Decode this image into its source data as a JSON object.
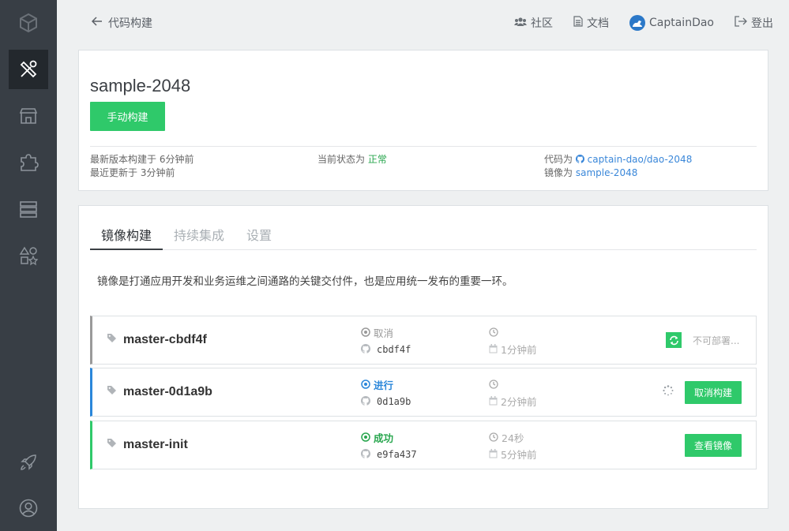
{
  "sidebar": {
    "items": [
      {
        "icon": "logo-cube-icon"
      },
      {
        "icon": "build-tools-icon",
        "active": true
      },
      {
        "icon": "store-icon"
      },
      {
        "icon": "plugin-icon"
      },
      {
        "icon": "server-list-icon"
      },
      {
        "icon": "shapes-icon"
      },
      {
        "icon": "rocket-icon"
      },
      {
        "icon": "user-icon"
      }
    ]
  },
  "topbar": {
    "back_label": "代码构建",
    "community": "社区",
    "docs": "文档",
    "username": "CaptainDao",
    "logout": "登出"
  },
  "app": {
    "name": "sample-2048",
    "build_button": "手动构建",
    "latest_build_label": "最新版本构建于",
    "latest_build_time": "6分钟前",
    "updated_label": "最近更新于",
    "updated_time": "3分钟前",
    "state_label": "当前状态为",
    "state_value": "正常",
    "code_label": "代码为",
    "code_repo": "captain-dao/dao-2048",
    "image_label": "镜像为",
    "image_name": "sample-2048"
  },
  "tabs": [
    {
      "label": "镜像构建",
      "active": true
    },
    {
      "label": "持续集成",
      "active": false
    },
    {
      "label": "设置",
      "active": false
    }
  ],
  "description": "镜像是打通应用开发和业务运维之间通路的关键交付件，也是应用统一发布的重要一环。",
  "builds": [
    {
      "name": "master-cbdf4f",
      "status": "取消",
      "status_color": "#999999",
      "border_color": "#9a9a9a",
      "commit": "cbdf4f",
      "duration": "",
      "created": "1分钟前",
      "action_label": "不可部署...",
      "action_type": "disabled"
    },
    {
      "name": "master-0d1a9b",
      "status": "进行",
      "status_color": "#2b87da",
      "border_color": "#2b87da",
      "commit": "0d1a9b",
      "duration": "",
      "created": "2分钟前",
      "action_label": "取消构建",
      "action_type": "button"
    },
    {
      "name": "master-init",
      "status": "成功",
      "status_color": "#28a64e",
      "border_color": "#2fc96a",
      "commit": "e9fa437",
      "duration": "24秒",
      "created": "5分钟前",
      "action_label": "查看镜像",
      "action_type": "button"
    }
  ],
  "colors": {
    "accent_green": "#2fc96a",
    "link_blue": "#3a87d9",
    "sidebar_bg": "#383e45"
  }
}
